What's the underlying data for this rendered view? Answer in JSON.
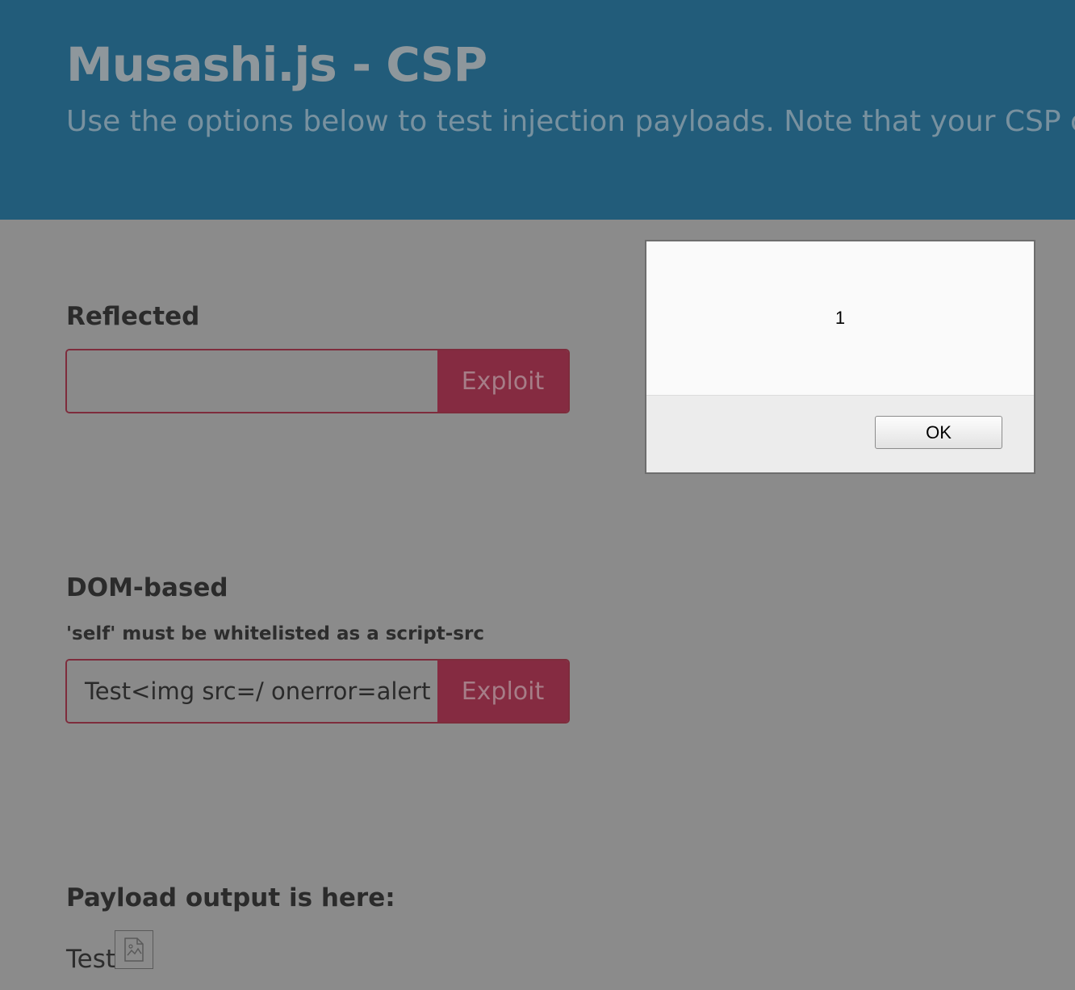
{
  "header": {
    "title": "Musashi.js - CSP",
    "subtitle": "Use the options below to test injection payloads. Note that your CSP can"
  },
  "reflected": {
    "heading": "Reflected",
    "input_value": "",
    "button_label": "Exploit"
  },
  "dom_based": {
    "heading": "DOM-based",
    "note": "'self' must be whitelisted as a script-src",
    "input_value": "Test<img src=/ onerror=alert",
    "button_label": "Exploit"
  },
  "output": {
    "heading": "Payload output is here:",
    "text": "Test",
    "image_icon": "broken-image-icon"
  },
  "alert_dialog": {
    "message": "1",
    "ok_label": "OK"
  },
  "colors": {
    "header_bg": "#225c7a",
    "page_overlay": "#8b8b8b",
    "accent": "#852b41"
  }
}
